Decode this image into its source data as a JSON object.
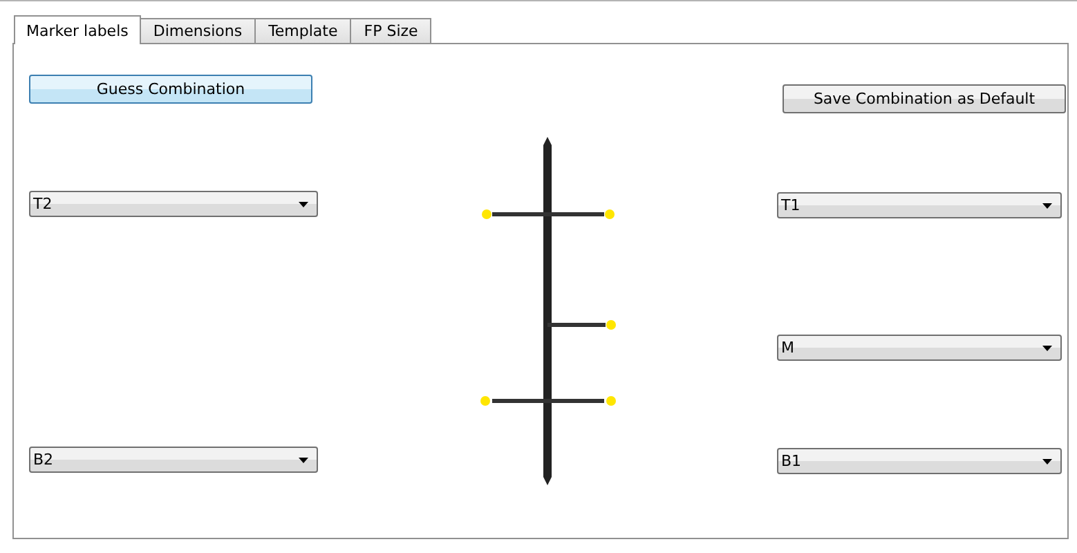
{
  "tabs": [
    {
      "label": "Marker labels",
      "selected": true
    },
    {
      "label": "Dimensions",
      "selected": false
    },
    {
      "label": "Template",
      "selected": false
    },
    {
      "label": "FP Size",
      "selected": false
    }
  ],
  "left": {
    "button": {
      "label": "Guess Combination",
      "default": true
    },
    "dropdowns": [
      {
        "value": "T2"
      },
      {
        "value": "B2"
      }
    ]
  },
  "right": {
    "button": {
      "label": "Save Combination as Default",
      "default": false
    },
    "dropdowns": [
      {
        "value": "T1"
      },
      {
        "value": "M"
      },
      {
        "value": "B1"
      }
    ]
  }
}
